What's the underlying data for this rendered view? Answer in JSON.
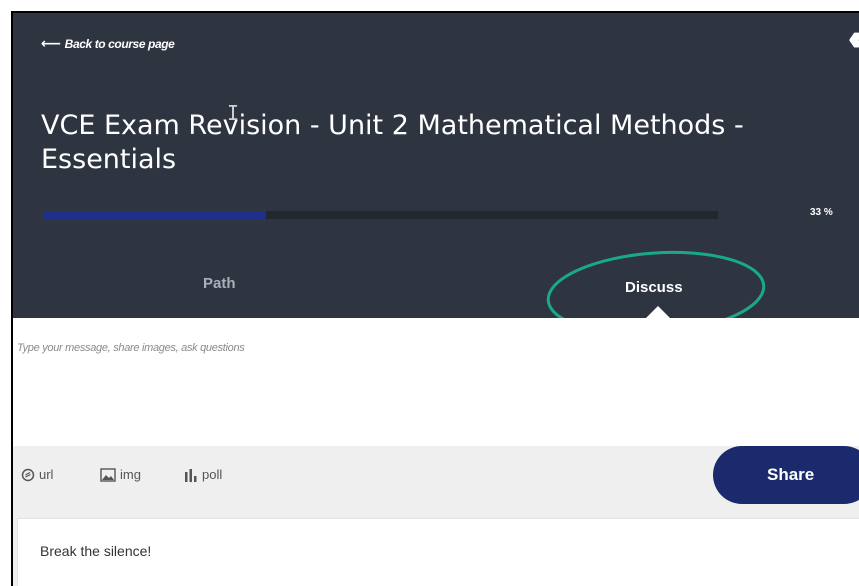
{
  "header": {
    "back_label": "Back to course page",
    "course_title": "VCE Exam Revision - Unit 2 Mathematical Methods - Essentials",
    "progress_fraction": 0.33,
    "progress_label": "33 %"
  },
  "tabs": [
    {
      "label": "Path",
      "active": false
    },
    {
      "label": "Discuss",
      "active": true
    }
  ],
  "composer": {
    "placeholder": "Type your message, share images, ask questions"
  },
  "toolbar": {
    "url_label": "url",
    "img_label": "img",
    "poll_label": "poll",
    "share_label": "Share"
  },
  "feed": {
    "empty_message": "Break the silence!"
  },
  "colors": {
    "header_bg": "#2e3440",
    "progress_fill": "#1e2f8c",
    "share_bg": "#1a2a6c",
    "highlight_ring": "#1aa88a"
  },
  "icons": {
    "back": "arrow-left-icon",
    "collapse": "double-chevron-left-icon",
    "url": "link-circle-icon",
    "img": "image-icon",
    "poll": "bar-chart-icon"
  }
}
